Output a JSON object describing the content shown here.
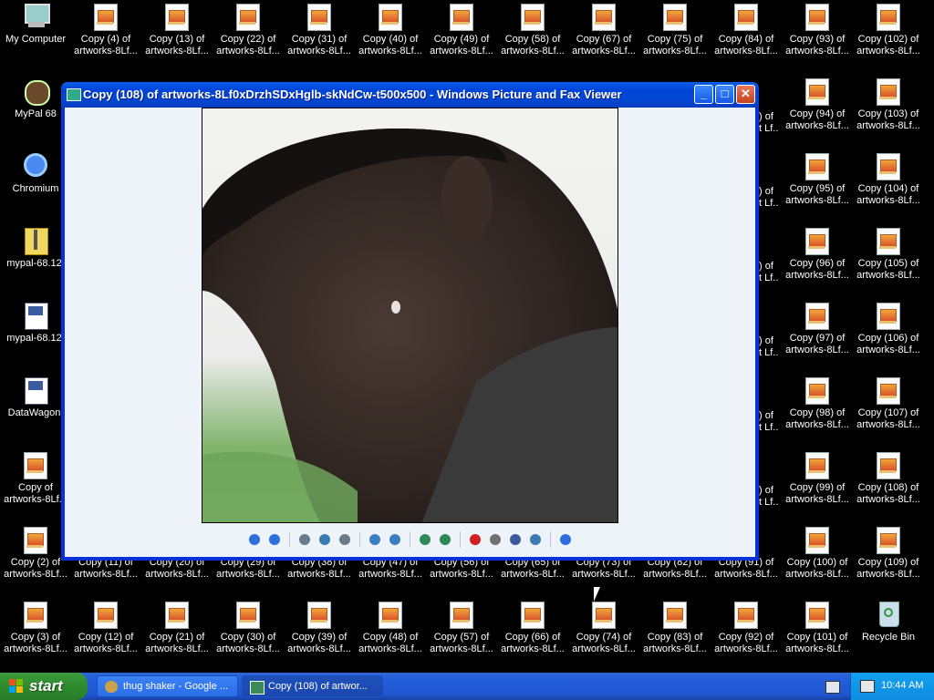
{
  "desktop": {
    "left_icons": [
      {
        "name": "my-computer",
        "label": "My Computer",
        "kind": "computer"
      },
      {
        "name": "mypal-68",
        "label": "MyPal 68",
        "kind": "app"
      },
      {
        "name": "chromium",
        "label": "Chromium",
        "kind": "chromium"
      },
      {
        "name": "mypal-zip",
        "label": "mypal-68.12.",
        "kind": "zip"
      },
      {
        "name": "mypal-installer",
        "label": "mypal-68.12.",
        "kind": "setup"
      },
      {
        "name": "datawagon",
        "label": "DataWagon.",
        "kind": "setup"
      },
      {
        "name": "copy-of",
        "label": "Copy of\nartworks-8Lf...",
        "kind": "image"
      },
      {
        "name": "copy-2",
        "label": "Copy (2) of\nartworks-8Lf...",
        "kind": "image"
      },
      {
        "name": "copy-3",
        "label": "Copy (3) of\nartworks-8Lf...",
        "kind": "image"
      }
    ],
    "top_row": [
      "Copy (4) of",
      "Copy (13) of",
      "Copy (22) of",
      "Copy (31) of",
      "Copy (40) of",
      "Copy (49) of",
      "Copy (58) of",
      "Copy (67) of",
      "Copy (75) of",
      "Copy (84) of",
      "Copy (93) of",
      "Copy (102) of"
    ],
    "row_bottom1": [
      "Copy (11) of",
      "Copy (20) of",
      "Copy (29) of",
      "Copy (38) of",
      "Copy (47) of",
      "Copy (56) of",
      "Copy (65) of",
      "Copy (73) of",
      "Copy (82) of",
      "Copy (91) of",
      "Copy (100) of",
      "Copy (109) of"
    ],
    "row_bottom2": [
      "Copy (12) of",
      "Copy (21) of",
      "Copy (30) of",
      "Copy (39) of",
      "Copy (48) of",
      "Copy (57) of",
      "Copy (66) of",
      "Copy (74) of",
      "Copy (83) of",
      "Copy (92) of",
      "Copy (101) of"
    ],
    "col_right1": [
      "Copy (94) of",
      "Copy (95) of",
      "Copy (96) of",
      "Copy (97) of",
      "Copy (98) of",
      "Copy (99) of"
    ],
    "col_right2": [
      "Copy (103) of",
      "Copy (104) of",
      "Copy (105) of",
      "Copy (106) of",
      "Copy (107) of",
      "Copy (108) of"
    ],
    "partial_label": ") of",
    "partial_sub": "t Lf...",
    "sub_label": "artworks-8Lf...",
    "recycle_bin": "Recycle Bin"
  },
  "window": {
    "title": "Copy (108) of artworks-8Lf0xDrzhSDxHglb-skNdCw-t500x500 - Windows Picture and Fax Viewer",
    "buttons": {
      "minimize": "_",
      "maximize": "□",
      "close": "✕"
    },
    "toolbar": [
      {
        "name": "previous-image-icon",
        "color": "#2a6fdc"
      },
      {
        "name": "next-image-icon",
        "color": "#2a6fdc"
      },
      {
        "name": "sep"
      },
      {
        "name": "best-fit-icon",
        "color": "#6a7a8a"
      },
      {
        "name": "actual-size-icon",
        "color": "#3a7ab0"
      },
      {
        "name": "slideshow-icon",
        "color": "#6a7a8a"
      },
      {
        "name": "sep"
      },
      {
        "name": "zoom-in-icon",
        "color": "#3a80c0"
      },
      {
        "name": "zoom-out-icon",
        "color": "#3a80c0"
      },
      {
        "name": "sep"
      },
      {
        "name": "rotate-clockwise-icon",
        "color": "#2e8b57"
      },
      {
        "name": "rotate-counterclockwise-icon",
        "color": "#2e8b57"
      },
      {
        "name": "sep"
      },
      {
        "name": "delete-icon",
        "color": "#d02020"
      },
      {
        "name": "print-icon",
        "color": "#707070"
      },
      {
        "name": "save-icon",
        "color": "#3a5a9a"
      },
      {
        "name": "edit-icon",
        "color": "#3a7ab0"
      },
      {
        "name": "sep"
      },
      {
        "name": "help-icon",
        "color": "#2a6fdc"
      }
    ]
  },
  "taskbar": {
    "start_label": "start",
    "tasks": [
      {
        "label": "thug shaker - Google ...",
        "active": false
      },
      {
        "label": "Copy (108) of artwor...",
        "active": true
      }
    ],
    "clock": "10:44 AM"
  }
}
